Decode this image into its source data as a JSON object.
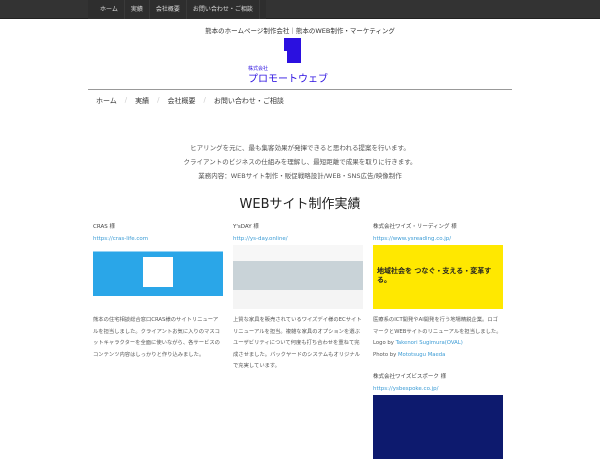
{
  "topnav": [
    "ホーム",
    "実績",
    "会社概要",
    "お問い合わせ・ご相談"
  ],
  "tagline": "熊本のホームページ制作会社｜熊本のWEB制作・マーケティング",
  "logo": {
    "small": "株式会社",
    "name": "プロモートウェブ",
    "color": "#2b10e0"
  },
  "mainnav": [
    "ホーム",
    "実績",
    "会社概要",
    "お問い合わせ・ご相談"
  ],
  "intro": [
    "ヒアリングを元に、最も集客効果が発揮できると思われる提案を行います。",
    "クライアントのビジネスの仕組みを理解し、最短距離で成果を取りに行きます。",
    "業務内容：WEBサイト制作・販促戦略設計/WEB・SNS広告/映像制作"
  ],
  "section_title": "WEBサイト制作実績",
  "works": [
    {
      "name": "CRAS 様",
      "url": "https://cras-life.com",
      "desc": "熊本の住宅相談総合窓口CRAS様のサイトリニューアルを担当しました。クライアントお気に入りのマスコットキャラクターを全面に使いながら、各サービスのコンテンツ内容はしっかりと作り込みました。"
    },
    {
      "name": "Y'sDAY 様",
      "url": "http://ys-day.online/",
      "desc": "上質な家具を販売されているワイズデイ様のECサイトリニューアルを担当。複雑な家具のオプションを選ぶユーザビリティについて何度も打ち合わせを重ねて完成させました。バックヤードのシステムもオリジナルで充実しています。"
    },
    {
      "name": "株式会社ワイズ・リーディング 様",
      "url": "https://www.ysreading.co.jp/",
      "desc": "医療系のICT開発やAI開発を行う地場精鋭企業。ロゴマークとWEBサイトのリニューアルを担当しました。",
      "logo_by": "Logo by",
      "logo_name": "Takenori Sugimura(OVAL)",
      "photo_by": "Photo by",
      "photo_name": "Mototsugu Maeda",
      "thumb_text": "地域社会を つなぐ・支える・変革する。"
    },
    {
      "name": "株式会社ワイズビスポーク 様",
      "url": "https://ysbespoke.co.jp/"
    }
  ]
}
